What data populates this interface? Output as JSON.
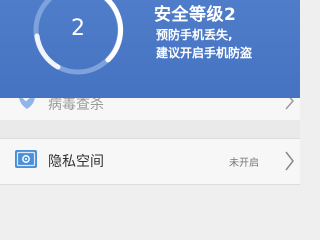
{
  "header": {
    "gauge_value": "2",
    "title": "安全等级2",
    "line1": "预防手机丢失,",
    "line2": "建议开启手机防盗"
  },
  "list": {
    "items": [
      {
        "label": "病毒查杀",
        "icon": "shield-icon"
      },
      {
        "label": "隐私空间",
        "status": "未开启",
        "icon": "privacy-vault-icon"
      }
    ]
  },
  "colors": {
    "header_bg": "#4a78c6",
    "gauge_ring": "#ffffff",
    "gauge_track": "#7fa2dc",
    "icon_blue": "#4b8fd8"
  }
}
